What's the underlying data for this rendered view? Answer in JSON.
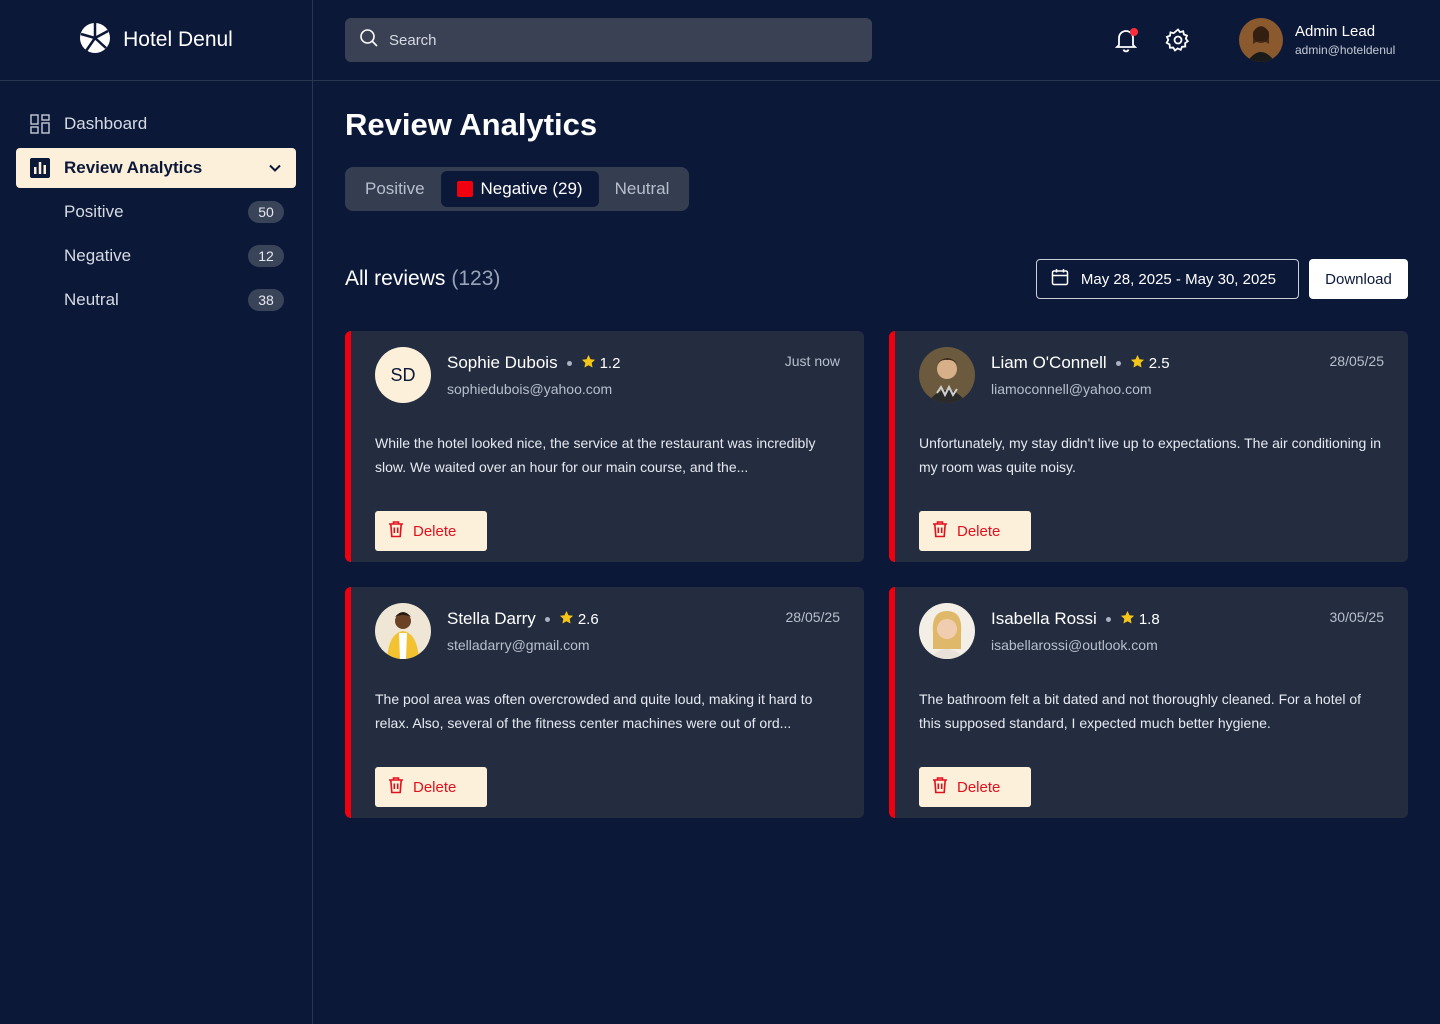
{
  "brand": {
    "name": "Hotel Denul"
  },
  "search": {
    "placeholder": "Search"
  },
  "user": {
    "name": "Admin Lead",
    "email": "admin@hoteldenul"
  },
  "sidebar": {
    "items": [
      {
        "label": "Dashboard",
        "icon": "dashboard-icon"
      },
      {
        "label": "Review Analytics",
        "icon": "bar-chart-icon",
        "active": true
      }
    ],
    "subitems": [
      {
        "label": "Positive",
        "count": "50"
      },
      {
        "label": "Negative",
        "count": "12"
      },
      {
        "label": "Neutral",
        "count": "38"
      }
    ]
  },
  "main": {
    "title": "Review Analytics",
    "tabs": [
      {
        "label": "Positive"
      },
      {
        "label": "Negative (29)",
        "active": true
      },
      {
        "label": "Neutral"
      }
    ],
    "list_title": "All reviews",
    "list_count": "(123)",
    "date_range": "May 28, 2025 - May 30, 2025",
    "download_label": "Download"
  },
  "reviews": [
    {
      "name": "Sophie Dubois",
      "initials": "SD",
      "rating": "1.2",
      "email": "sophiedubois@yahoo.com",
      "date": "Just now",
      "text": "While the hotel looked nice, the service at the restaurant was incredibly slow. We waited over an hour for our main course, and the...",
      "delete_label": "Delete"
    },
    {
      "name": "Liam O'Connell",
      "rating": "2.5",
      "email": "liamoconnell@yahoo.com",
      "date": "28/05/25",
      "text": "Unfortunately, my stay didn't live up to expectations. The air conditioning in my room was quite noisy.",
      "delete_label": "Delete"
    },
    {
      "name": "Stella Darry",
      "rating": "2.6",
      "email": "stelladarry@gmail.com",
      "date": "28/05/25",
      "text": "The pool area was often overcrowded and quite loud, making it hard to relax. Also, several of the fitness center machines were out of ord...",
      "delete_label": "Delete"
    },
    {
      "name": "Isabella Rossi",
      "rating": "1.8",
      "email": "isabellarossi@outlook.com",
      "date": "30/05/25",
      "text": "The bathroom felt a bit dated and not thoroughly cleaned. For a hotel of this supposed standard, I expected much better hygiene.",
      "delete_label": "Delete"
    }
  ],
  "colors": {
    "background": "#0b1838",
    "accent": "#fdf0db",
    "negative": "#f0000f",
    "card": "#242d40",
    "star": "#f5c518"
  }
}
